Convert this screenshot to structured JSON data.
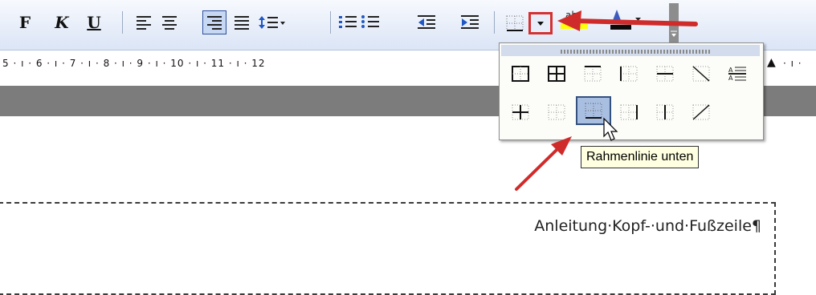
{
  "toolbar": {
    "bold_label": "F",
    "italic_label": "K",
    "underline_label": "U",
    "highlight_label": "ab"
  },
  "ruler": {
    "text": "5 · ı · 6 · ı · 7 · ı · 8 · ı · 9 · ı · 10 · ı · 11 · ı · 12",
    "tail": "· ı ·"
  },
  "borders_popup": {
    "selected_item": "bottom-border",
    "tooltip": "Rahmenlinie unten"
  },
  "document": {
    "header_text": "Anleitung·Kopf-·und·Fußzeile¶"
  },
  "colors": {
    "annotation_arrow": "#d02b2b",
    "highlight_yellow": "#ffff00",
    "font_color_bar": "#0a0a0a"
  }
}
